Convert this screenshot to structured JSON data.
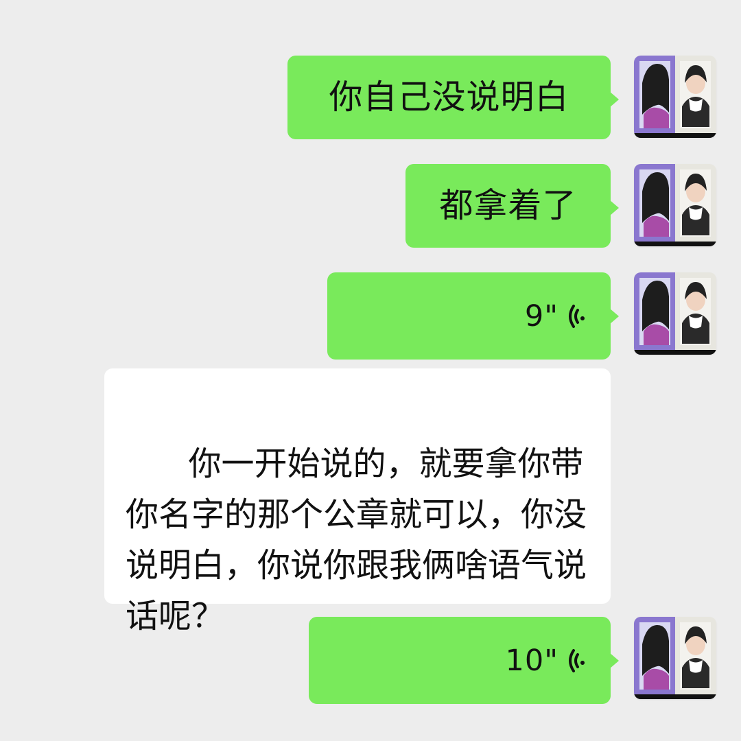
{
  "chat": {
    "top_fragment": "",
    "messages": [
      {
        "direction": "outgoing",
        "kind": "text",
        "text": "你自己没说明白"
      },
      {
        "direction": "outgoing",
        "kind": "text",
        "text": "都拿着了"
      },
      {
        "direction": "outgoing",
        "kind": "voice",
        "duration": "9\""
      },
      {
        "direction": "incoming",
        "kind": "text",
        "text": "你一开始说的，就要拿你带你名字的那个公章就可以，你没说明白，你说你跟我俩啥语气说话呢？"
      },
      {
        "direction": "outgoing",
        "kind": "voice",
        "duration": "10\""
      }
    ]
  },
  "colors": {
    "background": "#ededed",
    "outgoing_bubble": "#79ea5b",
    "incoming_bubble": "#ffffff",
    "text": "#111111"
  },
  "icons": {
    "voice": "voice-wave-icon",
    "avatar": "avatar-icon"
  }
}
